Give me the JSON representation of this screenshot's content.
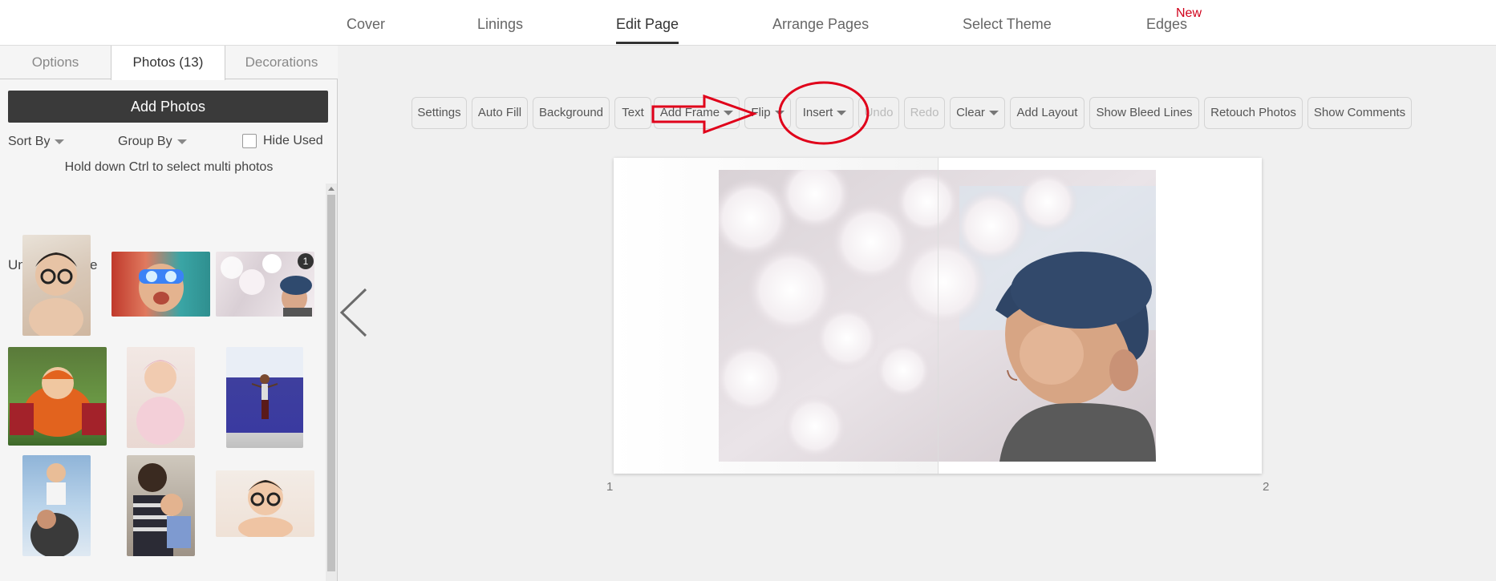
{
  "nav": {
    "items": [
      {
        "label": "Cover"
      },
      {
        "label": "Linings"
      },
      {
        "label": "Edit Page"
      },
      {
        "label": "Arrange Pages"
      },
      {
        "label": "Select Theme"
      },
      {
        "label": "Edges"
      }
    ],
    "new_badge": "New",
    "active": "Edit Page"
  },
  "sidebar": {
    "tabs": [
      {
        "label": "Options"
      },
      {
        "label": "Photos (13)"
      },
      {
        "label": "Decorations"
      }
    ],
    "active_tab": "Photos (13)",
    "add_photos_label": "Add Photos",
    "sort_by_label": "Sort By",
    "group_by_label": "Group By",
    "hide_used_label": "Hide Used",
    "hint": "Hold down Ctrl to select multi photos",
    "date_group_label": "Unknown Date",
    "used_badge": "1"
  },
  "toolbar": {
    "buttons": [
      {
        "label": "Settings",
        "dropdown": false,
        "disabled": false
      },
      {
        "label": "Auto Fill",
        "dropdown": false,
        "disabled": false
      },
      {
        "label": "Background",
        "dropdown": false,
        "disabled": false
      },
      {
        "label": "Text",
        "dropdown": false,
        "disabled": false
      },
      {
        "label": "Add Frame",
        "dropdown": true,
        "disabled": false
      },
      {
        "label": "Flip",
        "dropdown": true,
        "disabled": false
      },
      {
        "label": "Insert",
        "dropdown": true,
        "disabled": false
      },
      {
        "label": "Undo",
        "dropdown": false,
        "disabled": true
      },
      {
        "label": "Redo",
        "dropdown": false,
        "disabled": true
      },
      {
        "label": "Clear",
        "dropdown": true,
        "disabled": false
      },
      {
        "label": "Add Layout",
        "dropdown": false,
        "disabled": false
      },
      {
        "label": "Show Bleed Lines",
        "dropdown": false,
        "disabled": false
      },
      {
        "label": "Retouch Photos",
        "dropdown": false,
        "disabled": false
      },
      {
        "label": "Show Comments",
        "dropdown": false,
        "disabled": false
      }
    ]
  },
  "spread": {
    "left_page_number": "1",
    "right_page_number": "2"
  },
  "colors": {
    "accent_dark": "#3a3a3a",
    "new_badge": "#d0021b",
    "annotation_red": "#e0001a"
  },
  "icons": {
    "prev": "chevron-left-icon",
    "dropdown": "caret-down-icon"
  }
}
